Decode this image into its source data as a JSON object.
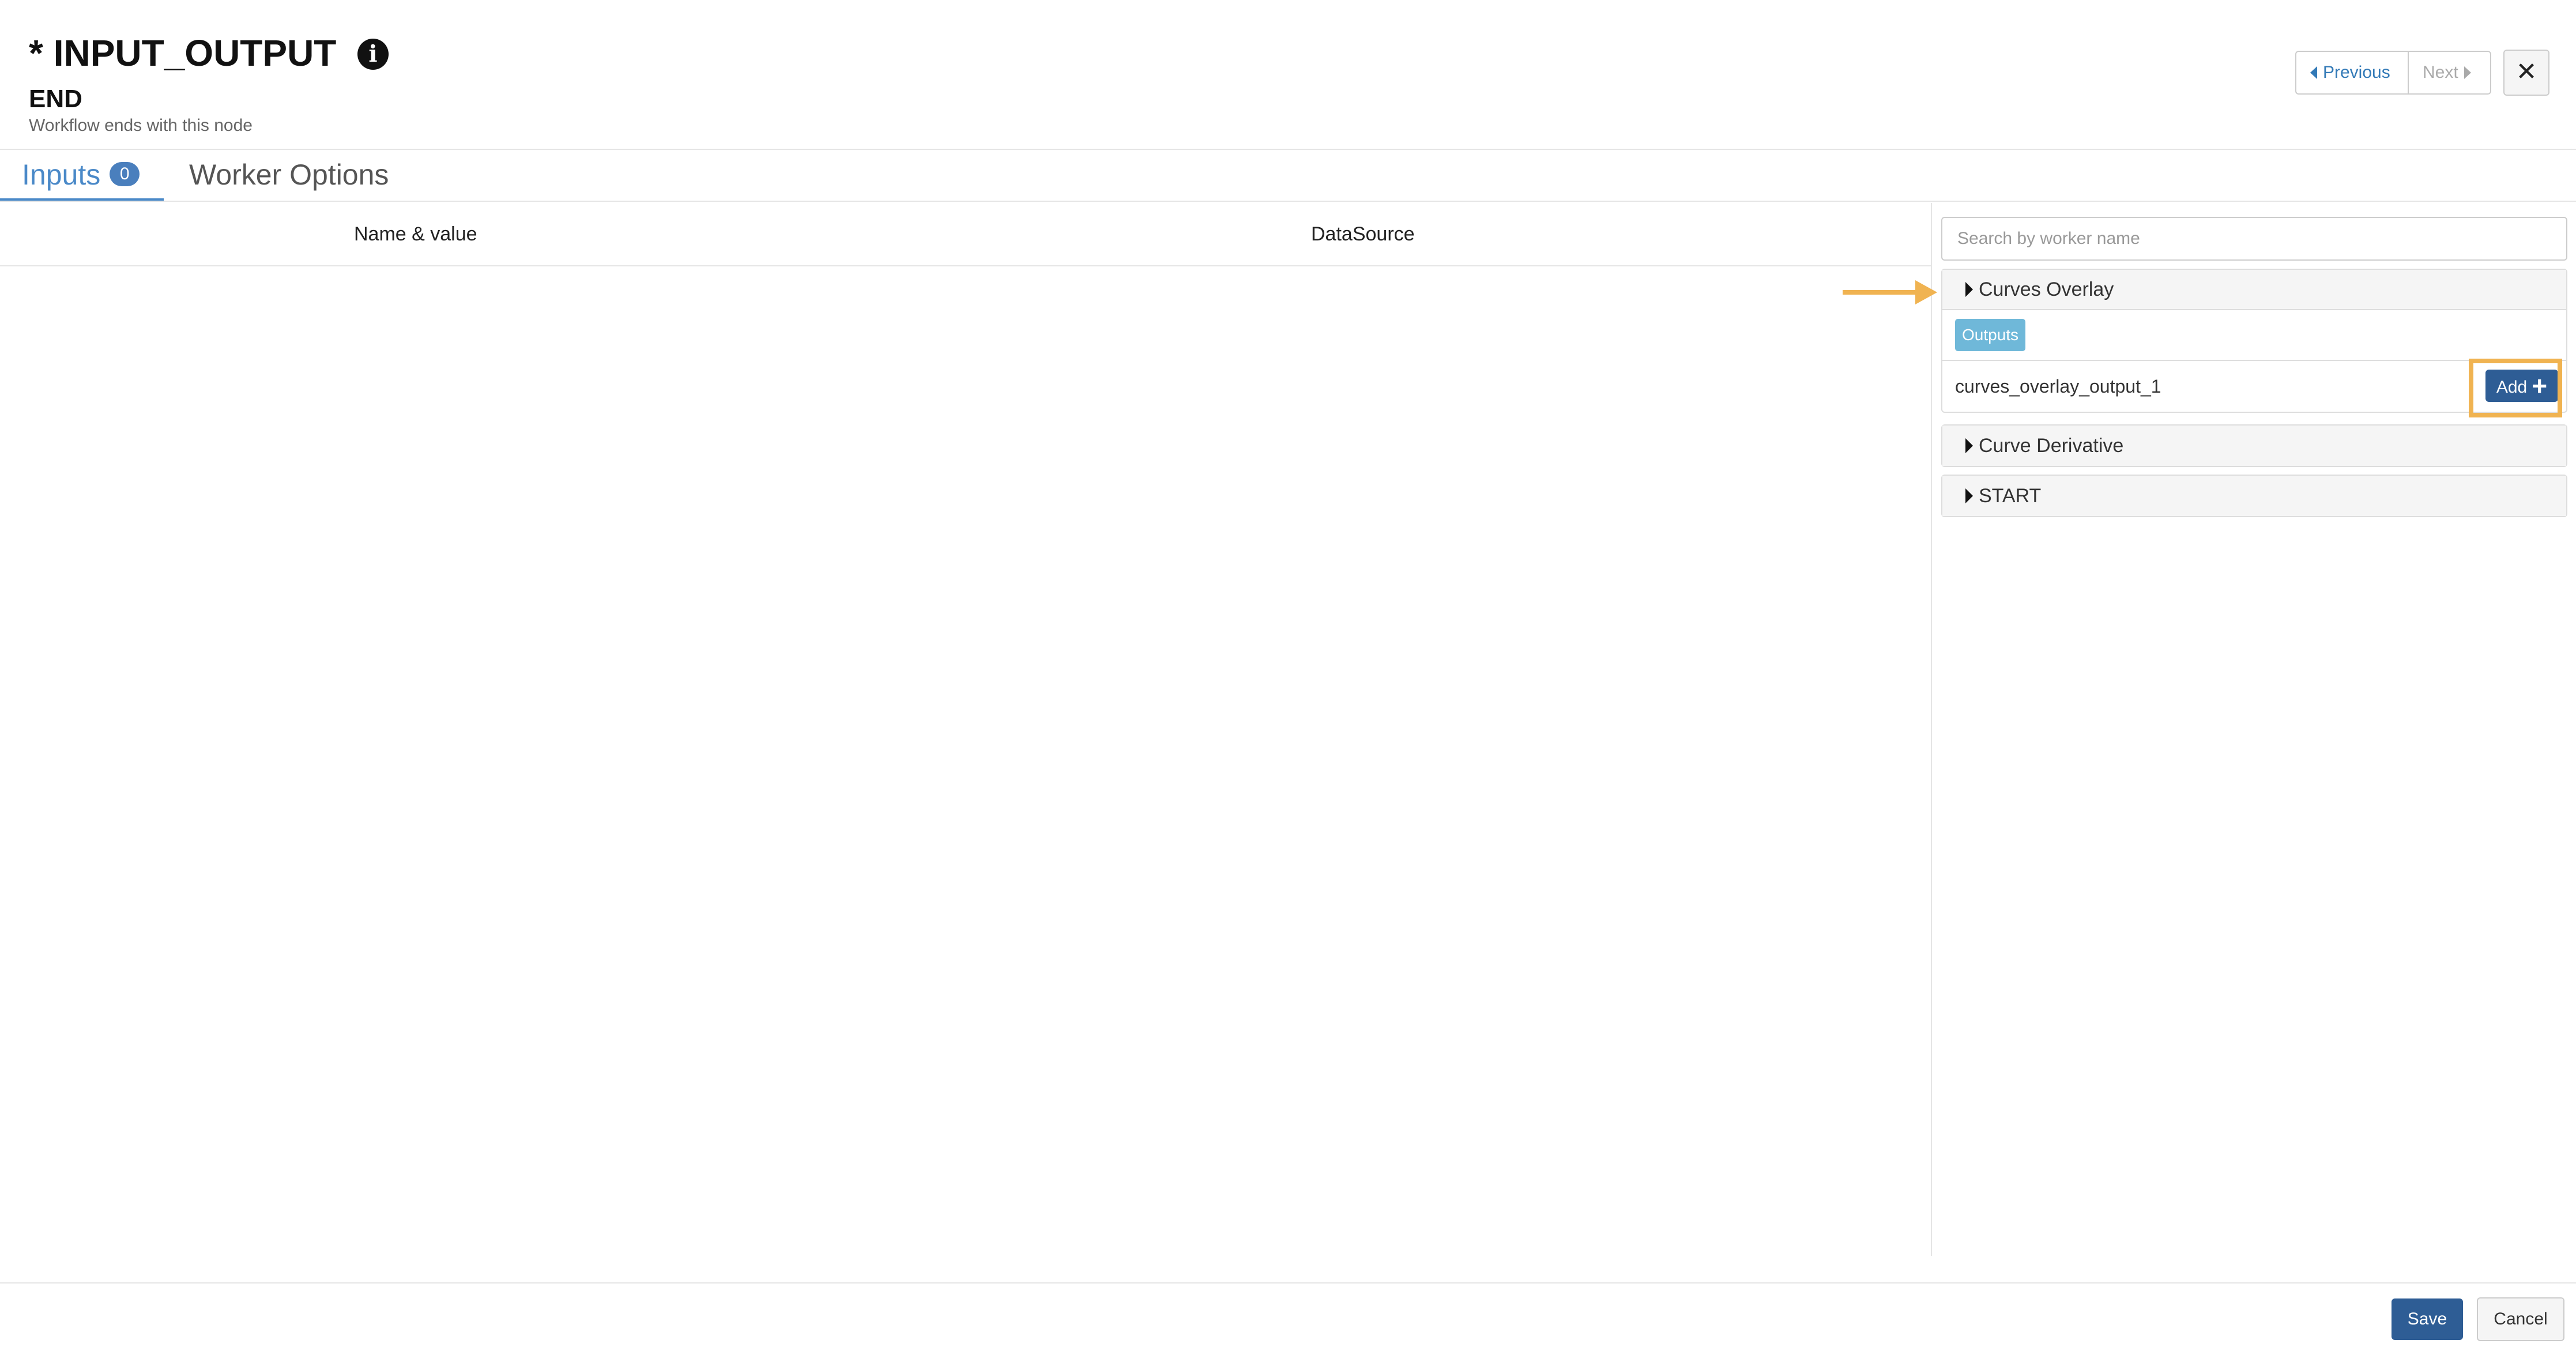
{
  "header": {
    "title": "* INPUT_OUTPUT",
    "info_icon": "info-circle-icon",
    "node_name": "END",
    "node_description": "Workflow ends with this node",
    "previous_label": "Previous",
    "next_label": "Next",
    "close_label": "✕"
  },
  "tabs": [
    {
      "label": "Inputs",
      "badge": "0",
      "active": true
    },
    {
      "label": "Worker Options",
      "active": false
    }
  ],
  "table": {
    "columns": [
      "Name & value",
      "DataSource"
    ]
  },
  "worker_panel": {
    "search_placeholder": "Search by worker name",
    "workers": [
      {
        "name": "Curves Overlay",
        "expanded": true,
        "outputs_label": "Outputs",
        "outputs": [
          {
            "name": "curves_overlay_output_1",
            "add_label": "Add",
            "add_icon": "+"
          }
        ]
      },
      {
        "name": "Curve Derivative",
        "expanded": false
      },
      {
        "name": "START",
        "expanded": false
      }
    ]
  },
  "footer": {
    "save_label": "Save",
    "cancel_label": "Cancel"
  },
  "colors": {
    "accent": "#4a89c8",
    "primary_button": "#2e5d95",
    "outputs_label": "#6fb8d9",
    "highlight": "#f0b351"
  }
}
